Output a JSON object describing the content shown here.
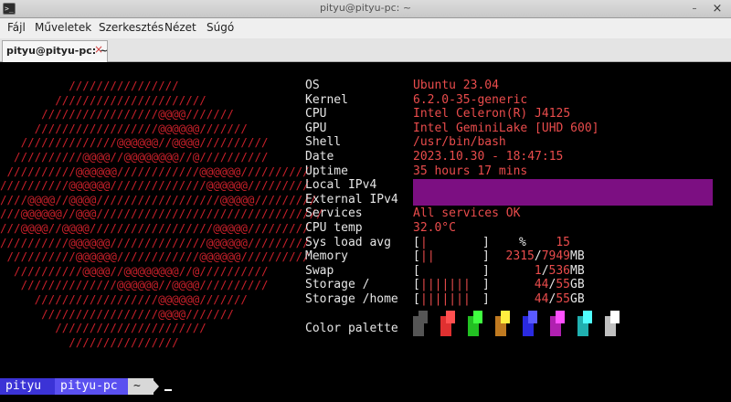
{
  "window": {
    "title": "pityu@pityu-pc: ~",
    "minimize_glyph": "–",
    "close_glyph": "×",
    "app_icon_glyph": ">_"
  },
  "menu": [
    "Fájl",
    "Műveletek",
    "Szerkesztés",
    "Nézet",
    "Súgó"
  ],
  "tab": {
    "label": "pityu@pityu-pc: ~",
    "close_glyph": "×"
  },
  "logo_lines": [
    "          ////////////////",
    "        //////////////////////",
    "      /////////////////@@@@///////",
    "     //////////////////@@@@@@///////",
    "   //////////////@@@@@@//@@@@//////////",
    "  //////////@@@@//@@@@@@@@//@//////////",
    " //////////@@@@@@////////////@@@@@@//////////",
    "//////////@@@@@@//////////////@@@@@@/////////",
    "////@@@@//@@@@//////////////////@@@@@/////////",
    "///@@@@@@//@@@/////////////////////////////////",
    "///@@@@//@@@@//////////////////@@@@@/////////",
    "//////////@@@@@@//////////////@@@@@@/////////",
    " //////////@@@@@@////////////@@@@@@//////////",
    "  //////////@@@@//@@@@@@@@//@//////////",
    "   //////////////@@@@@@//@@@@//////////",
    "     //////////////////@@@@@@///////",
    "      /////////////////@@@@///////",
    "        //////////////////////",
    "          ////////////////"
  ],
  "info": [
    {
      "label": "OS",
      "value": "Ubuntu 23.04"
    },
    {
      "label": "Kernel",
      "value": "6.2.0-35-generic"
    },
    {
      "label": "CPU",
      "value": "Intel Celeron(R) J4125"
    },
    {
      "label": "GPU",
      "value": "Intel GeminiLake [UHD 600]"
    },
    {
      "label": "Shell",
      "value": "/usr/bin/bash"
    },
    {
      "label": "Date",
      "value": "2023.10.30 - 18:47:15"
    },
    {
      "label": "Uptime",
      "value": "35 hours 17 mins"
    },
    {
      "label": "Local IPv4",
      "value": ""
    },
    {
      "label": "External IPv4",
      "value": ""
    },
    {
      "label": "Services",
      "value": "All services OK"
    },
    {
      "label": "CPU temp",
      "value": "32.0°C"
    }
  ],
  "gauges": [
    {
      "label": "Sys load avg",
      "bar": "|",
      "fill": 0.15,
      "used": "15",
      "total": "",
      "unit": "%"
    },
    {
      "label": "Memory",
      "bar": "||",
      "fill": 0.29,
      "used": "2315",
      "total": "7949",
      "unit": "MB"
    },
    {
      "label": "Swap",
      "bar": "",
      "fill": 0.0,
      "used": "1",
      "total": "536",
      "unit": "MB"
    },
    {
      "label": "Storage /",
      "bar": "|||||||",
      "fill": 0.8,
      "used": "44",
      "total": "55",
      "unit": "GB"
    },
    {
      "label": "Storage /home",
      "bar": "|||||||",
      "fill": 0.8,
      "used": "44",
      "total": "55",
      "unit": "GB"
    }
  ],
  "palette_label": "Color palette",
  "palette": [
    {
      "dark": "#555555",
      "light": "#555555"
    },
    {
      "dark": "#e03030",
      "light": "#ff5050"
    },
    {
      "dark": "#22c022",
      "light": "#40ff40"
    },
    {
      "dark": "#c07a20",
      "light": "#ffee40"
    },
    {
      "dark": "#2a2ae0",
      "light": "#5a5aff"
    },
    {
      "dark": "#b020b0",
      "light": "#ff50ff"
    },
    {
      "dark": "#20b0b0",
      "light": "#50ffff"
    },
    {
      "dark": "#c0c0c0",
      "light": "#ffffff"
    }
  ],
  "colors": {
    "accent_red": "#ea4c4c",
    "logo_red": "#c8202a",
    "ipv4_redaction": "#7c0f82",
    "prompt_user_bg": "#3b33d6",
    "prompt_host_bg": "#5a50f0"
  },
  "prompt": {
    "user": "pityu",
    "host": "pityu-pc",
    "dir": "~"
  }
}
